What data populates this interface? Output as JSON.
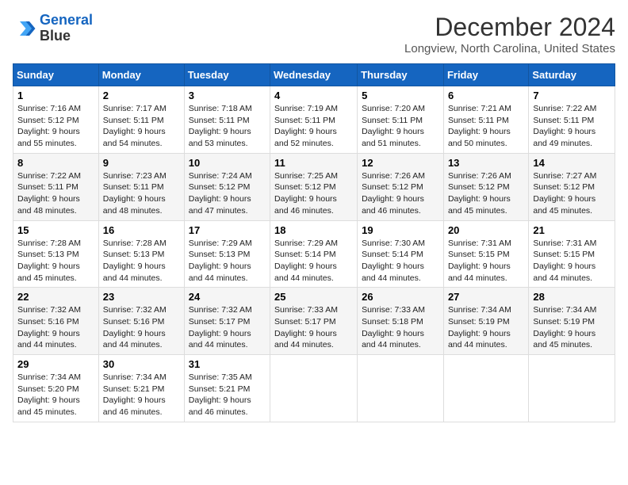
{
  "logo": {
    "line1": "General",
    "line2": "Blue"
  },
  "header": {
    "month": "December 2024",
    "location": "Longview, North Carolina, United States"
  },
  "days_of_week": [
    "Sunday",
    "Monday",
    "Tuesday",
    "Wednesday",
    "Thursday",
    "Friday",
    "Saturday"
  ],
  "weeks": [
    [
      {
        "day": "1",
        "sunrise": "Sunrise: 7:16 AM",
        "sunset": "Sunset: 5:12 PM",
        "daylight": "Daylight: 9 hours and 55 minutes."
      },
      {
        "day": "2",
        "sunrise": "Sunrise: 7:17 AM",
        "sunset": "Sunset: 5:11 PM",
        "daylight": "Daylight: 9 hours and 54 minutes."
      },
      {
        "day": "3",
        "sunrise": "Sunrise: 7:18 AM",
        "sunset": "Sunset: 5:11 PM",
        "daylight": "Daylight: 9 hours and 53 minutes."
      },
      {
        "day": "4",
        "sunrise": "Sunrise: 7:19 AM",
        "sunset": "Sunset: 5:11 PM",
        "daylight": "Daylight: 9 hours and 52 minutes."
      },
      {
        "day": "5",
        "sunrise": "Sunrise: 7:20 AM",
        "sunset": "Sunset: 5:11 PM",
        "daylight": "Daylight: 9 hours and 51 minutes."
      },
      {
        "day": "6",
        "sunrise": "Sunrise: 7:21 AM",
        "sunset": "Sunset: 5:11 PM",
        "daylight": "Daylight: 9 hours and 50 minutes."
      },
      {
        "day": "7",
        "sunrise": "Sunrise: 7:22 AM",
        "sunset": "Sunset: 5:11 PM",
        "daylight": "Daylight: 9 hours and 49 minutes."
      }
    ],
    [
      {
        "day": "8",
        "sunrise": "Sunrise: 7:22 AM",
        "sunset": "Sunset: 5:11 PM",
        "daylight": "Daylight: 9 hours and 48 minutes."
      },
      {
        "day": "9",
        "sunrise": "Sunrise: 7:23 AM",
        "sunset": "Sunset: 5:11 PM",
        "daylight": "Daylight: 9 hours and 48 minutes."
      },
      {
        "day": "10",
        "sunrise": "Sunrise: 7:24 AM",
        "sunset": "Sunset: 5:12 PM",
        "daylight": "Daylight: 9 hours and 47 minutes."
      },
      {
        "day": "11",
        "sunrise": "Sunrise: 7:25 AM",
        "sunset": "Sunset: 5:12 PM",
        "daylight": "Daylight: 9 hours and 46 minutes."
      },
      {
        "day": "12",
        "sunrise": "Sunrise: 7:26 AM",
        "sunset": "Sunset: 5:12 PM",
        "daylight": "Daylight: 9 hours and 46 minutes."
      },
      {
        "day": "13",
        "sunrise": "Sunrise: 7:26 AM",
        "sunset": "Sunset: 5:12 PM",
        "daylight": "Daylight: 9 hours and 45 minutes."
      },
      {
        "day": "14",
        "sunrise": "Sunrise: 7:27 AM",
        "sunset": "Sunset: 5:12 PM",
        "daylight": "Daylight: 9 hours and 45 minutes."
      }
    ],
    [
      {
        "day": "15",
        "sunrise": "Sunrise: 7:28 AM",
        "sunset": "Sunset: 5:13 PM",
        "daylight": "Daylight: 9 hours and 45 minutes."
      },
      {
        "day": "16",
        "sunrise": "Sunrise: 7:28 AM",
        "sunset": "Sunset: 5:13 PM",
        "daylight": "Daylight: 9 hours and 44 minutes."
      },
      {
        "day": "17",
        "sunrise": "Sunrise: 7:29 AM",
        "sunset": "Sunset: 5:13 PM",
        "daylight": "Daylight: 9 hours and 44 minutes."
      },
      {
        "day": "18",
        "sunrise": "Sunrise: 7:29 AM",
        "sunset": "Sunset: 5:14 PM",
        "daylight": "Daylight: 9 hours and 44 minutes."
      },
      {
        "day": "19",
        "sunrise": "Sunrise: 7:30 AM",
        "sunset": "Sunset: 5:14 PM",
        "daylight": "Daylight: 9 hours and 44 minutes."
      },
      {
        "day": "20",
        "sunrise": "Sunrise: 7:31 AM",
        "sunset": "Sunset: 5:15 PM",
        "daylight": "Daylight: 9 hours and 44 minutes."
      },
      {
        "day": "21",
        "sunrise": "Sunrise: 7:31 AM",
        "sunset": "Sunset: 5:15 PM",
        "daylight": "Daylight: 9 hours and 44 minutes."
      }
    ],
    [
      {
        "day": "22",
        "sunrise": "Sunrise: 7:32 AM",
        "sunset": "Sunset: 5:16 PM",
        "daylight": "Daylight: 9 hours and 44 minutes."
      },
      {
        "day": "23",
        "sunrise": "Sunrise: 7:32 AM",
        "sunset": "Sunset: 5:16 PM",
        "daylight": "Daylight: 9 hours and 44 minutes."
      },
      {
        "day": "24",
        "sunrise": "Sunrise: 7:32 AM",
        "sunset": "Sunset: 5:17 PM",
        "daylight": "Daylight: 9 hours and 44 minutes."
      },
      {
        "day": "25",
        "sunrise": "Sunrise: 7:33 AM",
        "sunset": "Sunset: 5:17 PM",
        "daylight": "Daylight: 9 hours and 44 minutes."
      },
      {
        "day": "26",
        "sunrise": "Sunrise: 7:33 AM",
        "sunset": "Sunset: 5:18 PM",
        "daylight": "Daylight: 9 hours and 44 minutes."
      },
      {
        "day": "27",
        "sunrise": "Sunrise: 7:34 AM",
        "sunset": "Sunset: 5:19 PM",
        "daylight": "Daylight: 9 hours and 44 minutes."
      },
      {
        "day": "28",
        "sunrise": "Sunrise: 7:34 AM",
        "sunset": "Sunset: 5:19 PM",
        "daylight": "Daylight: 9 hours and 45 minutes."
      }
    ],
    [
      {
        "day": "29",
        "sunrise": "Sunrise: 7:34 AM",
        "sunset": "Sunset: 5:20 PM",
        "daylight": "Daylight: 9 hours and 45 minutes."
      },
      {
        "day": "30",
        "sunrise": "Sunrise: 7:34 AM",
        "sunset": "Sunset: 5:21 PM",
        "daylight": "Daylight: 9 hours and 46 minutes."
      },
      {
        "day": "31",
        "sunrise": "Sunrise: 7:35 AM",
        "sunset": "Sunset: 5:21 PM",
        "daylight": "Daylight: 9 hours and 46 minutes."
      },
      {
        "day": "",
        "sunrise": "",
        "sunset": "",
        "daylight": ""
      },
      {
        "day": "",
        "sunrise": "",
        "sunset": "",
        "daylight": ""
      },
      {
        "day": "",
        "sunrise": "",
        "sunset": "",
        "daylight": ""
      },
      {
        "day": "",
        "sunrise": "",
        "sunset": "",
        "daylight": ""
      }
    ]
  ]
}
